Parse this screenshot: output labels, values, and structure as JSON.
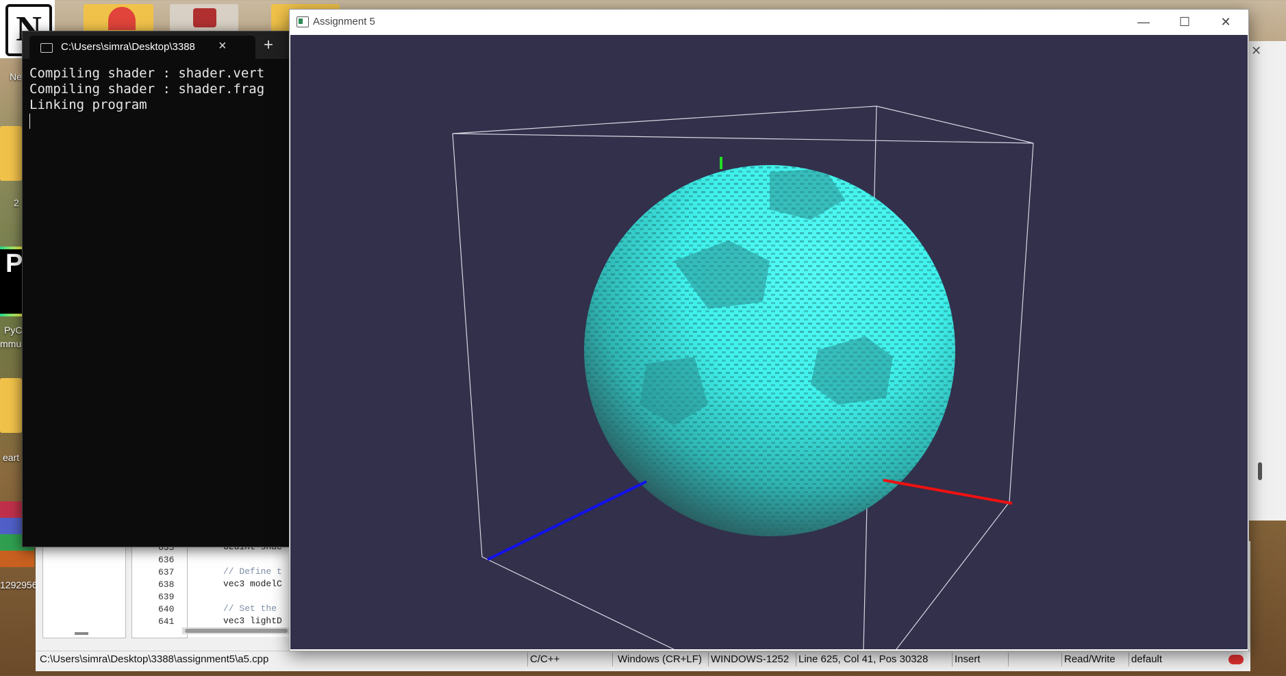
{
  "desktop": {
    "labels": [
      "Ne",
      "2",
      "PyC",
      "mmu",
      "eart",
      "1292956"
    ]
  },
  "editor": {
    "line_numbers": [
      "635",
      "636",
      "637",
      "638",
      "639",
      "640",
      "641"
    ],
    "code_lines": [
      "GLuint shac",
      "",
      "// Define t",
      "vec3 modelC",
      "",
      "// Set the",
      "vec3 lightD"
    ]
  },
  "status_bar": {
    "file_path": "C:\\Users\\simra\\Desktop\\3388\\assignment5\\a5.cpp",
    "language": "C/C++",
    "line_endings": "Windows (CR+LF)",
    "encoding": "WINDOWS-1252",
    "position": "Line 625, Col 41, Pos 30328",
    "mode": "Insert",
    "access": "Read/Write",
    "profile": "default"
  },
  "terminal": {
    "tab_title": "C:\\Users\\simra\\Desktop\\3388",
    "output": "Compiling shader : shader.vert\nCompiling shader : shader.frag\nLinking program"
  },
  "gl_window": {
    "title": "Assignment 5",
    "background": "#32304b",
    "sphere_color": "#3ff5ee",
    "axis_colors": {
      "x": "#ee1111",
      "y": "#22dd22",
      "z": "#1111ee"
    }
  }
}
